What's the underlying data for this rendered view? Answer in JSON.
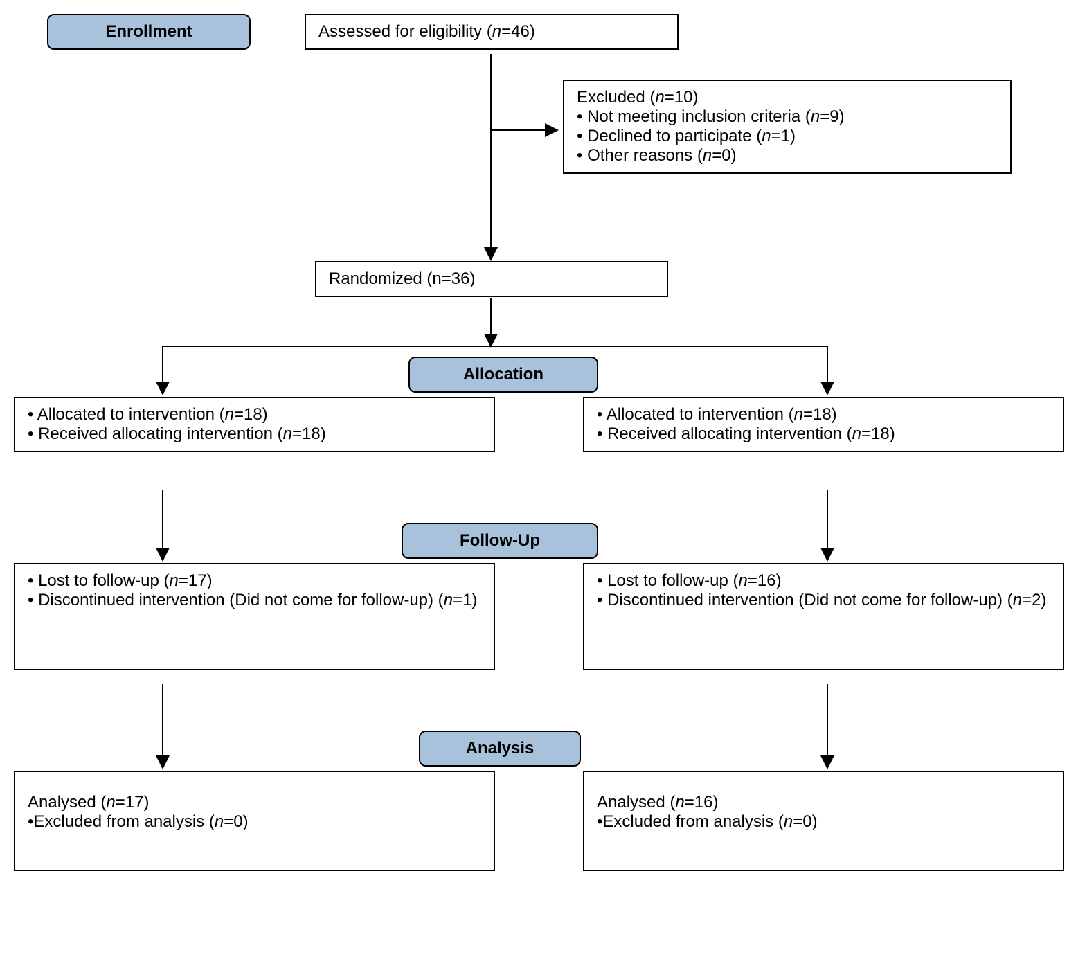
{
  "phases": {
    "enrollment": "Enrollment",
    "allocation": "Allocation",
    "followup": "Follow-Up",
    "analysis": "Analysis"
  },
  "assessed": {
    "label": "Assessed for eligibility",
    "n": 46
  },
  "excluded": {
    "label": "Excluded",
    "n": 10,
    "reasons": [
      {
        "label": "Not meeting inclusion criteria",
        "n": 9
      },
      {
        "label": "Declined to participate",
        "n": 1
      },
      {
        "label": "Other reasons",
        "n": 0
      }
    ]
  },
  "randomized": {
    "label": "Randomized",
    "n": 36
  },
  "allocation": {
    "left": {
      "allocated": {
        "label": "Allocated to intervention",
        "n": 18
      },
      "received": {
        "label": "Received allocating intervention",
        "n": 18
      }
    },
    "right": {
      "allocated": {
        "label": "Allocated to intervention",
        "n": 18
      },
      "received": {
        "label": "Received allocating intervention",
        "n": 18
      }
    }
  },
  "followup": {
    "left": {
      "lost": {
        "label": "Lost to follow-up",
        "n": 17
      },
      "discontinued": {
        "label": "Discontinued intervention (Did not come for follow-up)",
        "n": 1
      }
    },
    "right": {
      "lost": {
        "label": "Lost to follow-up",
        "n": 16
      },
      "discontinued": {
        "label": "Discontinued intervention (Did not come for follow-up)",
        "n": 2
      }
    }
  },
  "analysis": {
    "left": {
      "analysed": {
        "label": "Analysed",
        "n": 17
      },
      "excluded": {
        "label": "Excluded from analysis",
        "n": 0
      }
    },
    "right": {
      "analysed": {
        "label": "Analysed",
        "n": 16
      },
      "excluded": {
        "label": "Excluded from analysis",
        "n": 0
      }
    }
  }
}
